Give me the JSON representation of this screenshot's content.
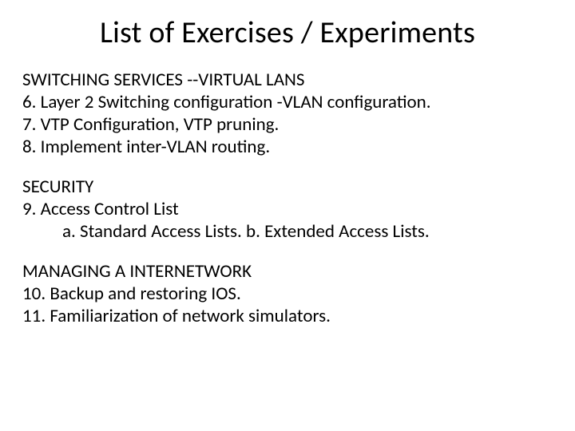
{
  "title": "List of Exercises / Experiments",
  "sections": [
    {
      "heading": "SWITCHING SERVICES --VIRTUAL LANS",
      "lines": [
        "6. Layer 2 Switching configuration -VLAN configuration.",
        "7. VTP Configuration, VTP pruning.",
        "8. Implement inter-VLAN routing."
      ],
      "sublines": []
    },
    {
      "heading": "SECURITY",
      "lines": [
        "9. Access Control List"
      ],
      "sublines": [
        "a. Standard Access Lists. b. Extended Access Lists."
      ]
    },
    {
      "heading": "MANAGING A INTERNETWORK",
      "lines": [
        "10. Backup and restoring IOS.",
        "11. Familiarization of network simulators."
      ],
      "sublines": []
    }
  ]
}
